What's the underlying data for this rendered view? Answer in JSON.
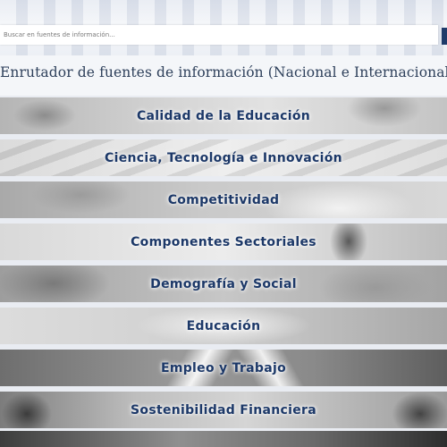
{
  "search": {
    "placeholder": "Buscar en fuentes de información..."
  },
  "page": {
    "title": "Enrutador de fuentes de información (Nacional e Internacional)"
  },
  "colors": {
    "accent": "#1f3b6a",
    "label": "#1c3868",
    "divider": "#c7d3ea"
  },
  "menu": {
    "items": [
      {
        "label": "Calidad de la Educación"
      },
      {
        "label": "Ciencia, Tecnología e Innovación"
      },
      {
        "label": "Competitividad"
      },
      {
        "label": "Componentes Sectoriales"
      },
      {
        "label": "Demografía y Social"
      },
      {
        "label": "Educación"
      },
      {
        "label": "Empleo y Trabajo"
      },
      {
        "label": "Sostenibilidad Financiera"
      }
    ]
  }
}
